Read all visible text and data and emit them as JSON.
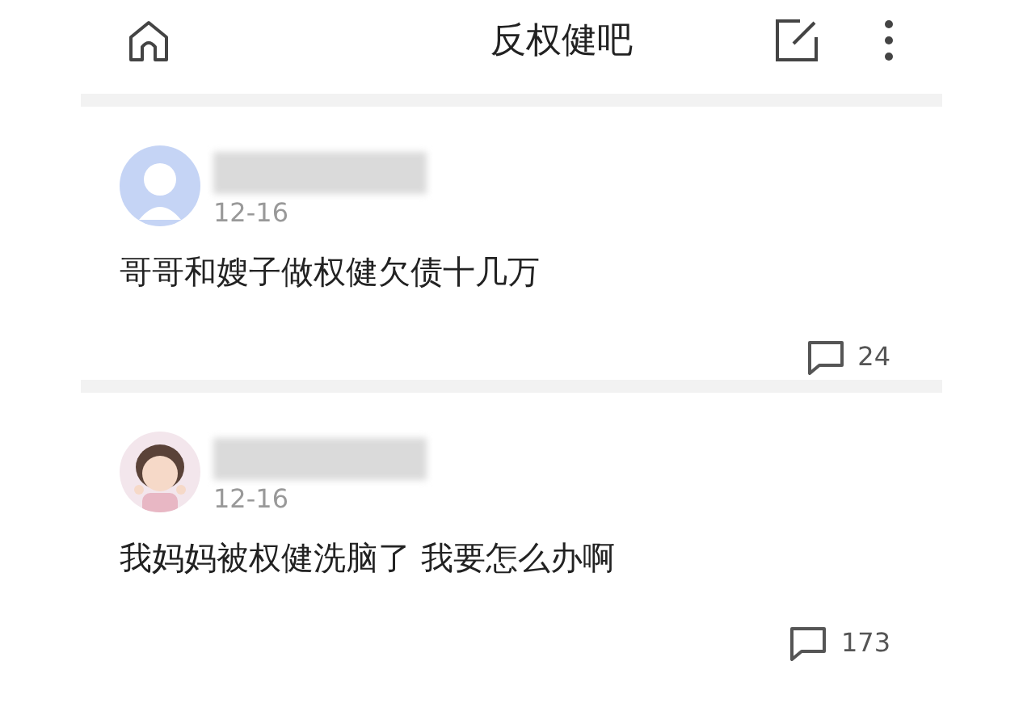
{
  "header": {
    "title": "反权健吧"
  },
  "posts": [
    {
      "kind": "default",
      "date": "12-16",
      "title": "哥哥和嫂子做权健欠债十几万",
      "comments": "24"
    },
    {
      "kind": "picture",
      "date": "12-16",
      "title": "我妈妈被权健洗脑了 我要怎么办啊",
      "comments": "173"
    }
  ]
}
